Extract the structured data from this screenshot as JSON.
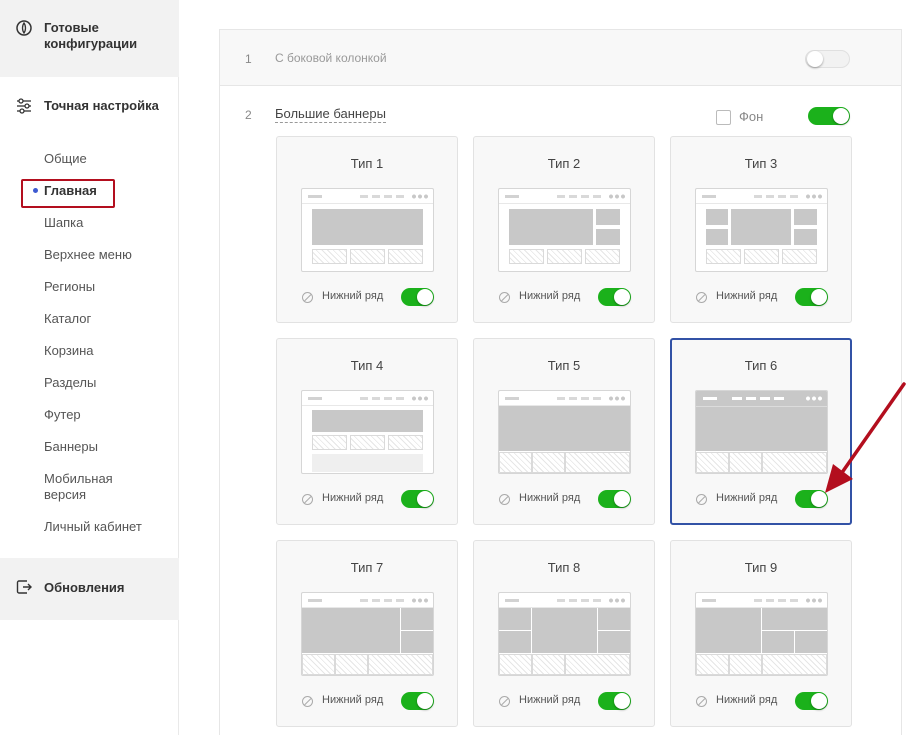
{
  "sidebar": {
    "ready_configs": "Готовые конфигурации",
    "fine_tuning": "Точная настройка",
    "items": [
      {
        "label": "Общие"
      },
      {
        "label": "Главная",
        "active": true
      },
      {
        "label": "Шапка"
      },
      {
        "label": "Верхнее меню"
      },
      {
        "label": "Регионы"
      },
      {
        "label": "Каталог"
      },
      {
        "label": "Корзина"
      },
      {
        "label": "Разделы"
      },
      {
        "label": "Футер"
      },
      {
        "label": "Баннеры"
      },
      {
        "label": "Мобильная версия"
      },
      {
        "label": "Личный кабинет"
      }
    ],
    "updates": "Обновления"
  },
  "main": {
    "row1": {
      "number": "1",
      "label": "С боковой колонкой",
      "enabled": false
    },
    "row2": {
      "number": "2",
      "label": "Большие баннеры",
      "background_label": "Фон",
      "background_checked": false,
      "enabled": true
    },
    "bottom_row_label": "Нижний ряд",
    "cards": [
      {
        "title": "Тип 1",
        "bottom_row": true
      },
      {
        "title": "Тип 2",
        "bottom_row": true
      },
      {
        "title": "Тип 3",
        "bottom_row": true
      },
      {
        "title": "Тип 4",
        "bottom_row": true
      },
      {
        "title": "Тип 5",
        "bottom_row": true
      },
      {
        "title": "Тип 6",
        "bottom_row": true,
        "selected": true
      },
      {
        "title": "Тип 7",
        "bottom_row": true
      },
      {
        "title": "Тип 8",
        "bottom_row": true
      },
      {
        "title": "Тип 9",
        "bottom_row": true
      }
    ]
  },
  "colors": {
    "toggle_on": "#1bb11b",
    "selected_border": "#3252a6",
    "active_dot": "#3d5ad1",
    "annotation": "#b30e1e"
  }
}
